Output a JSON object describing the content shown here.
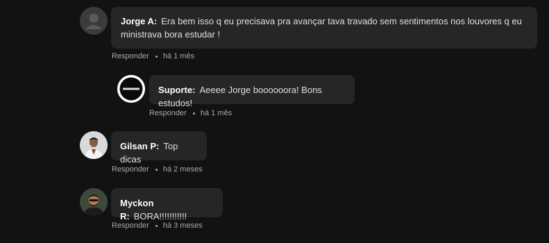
{
  "comments": [
    {
      "author": "Jorge A:",
      "text": "Era bem isso q eu precisava pra avançar tava travado sem sentimentos nos louvores q eu ministrava bora estudar !",
      "reply_label": "Responder",
      "time": "há 1 mês",
      "avatar": "default-user-avatar",
      "replies": [
        {
          "author": "Suporte:",
          "text": "Aeeee Jorge boooooora! Bons estudos!",
          "reply_label": "Responder",
          "time": "há 1 mês",
          "avatar": "brand-logo-avatar"
        }
      ]
    },
    {
      "author": "Gilsan P:",
      "text": "Top dicas",
      "reply_label": "Responder",
      "time": "há 2 meses",
      "avatar": "user-photo-avatar"
    },
    {
      "author": "Myckon R:",
      "text": "BORA!!!!!!!!!!!",
      "reply_label": "Responder",
      "time": "há 3 meses",
      "avatar": "user-photo-avatar"
    }
  ],
  "colors": {
    "background": "#121212",
    "bubble": "#262626",
    "meta_text": "#a9a9a9"
  }
}
